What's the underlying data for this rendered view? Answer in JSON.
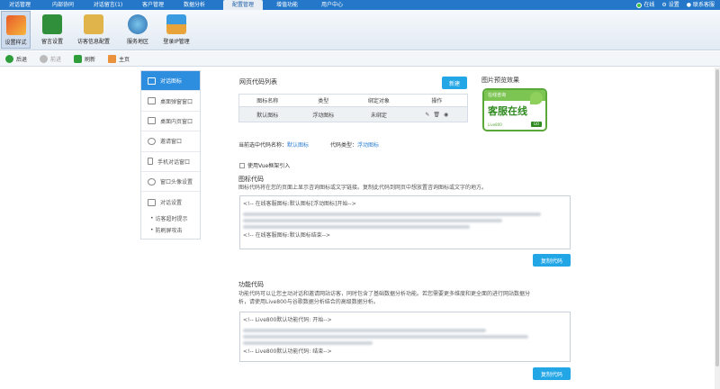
{
  "topbar": {
    "tabs": [
      "对话管理",
      "内部协同",
      "对话留言(1)",
      "客户管理",
      "数据分析",
      "配置管理",
      "增值功能",
      "用户中心"
    ],
    "active_tab": "配置管理",
    "status": "在线",
    "settings": "设置",
    "contact": "联系客服"
  },
  "toolbar": {
    "items": [
      {
        "label": "设置样式",
        "icon": "paint-brush-icon"
      },
      {
        "label": "留言设置",
        "icon": "message-book-icon"
      },
      {
        "label": "访客信息配置",
        "icon": "visitor-box-icon"
      },
      {
        "label": "服务地区",
        "icon": "globe-icon"
      },
      {
        "label": "登录IP管理",
        "icon": "ip-map-icon"
      }
    ]
  },
  "navbar": {
    "back": "后退",
    "forward": "前进",
    "refresh": "刷新",
    "home": "主页"
  },
  "left_menu": {
    "items": [
      "对话图标",
      "桌面弹窗窗口",
      "桌面内页窗口",
      "邀请窗口",
      "手机对话窗口",
      "窗口头像设置",
      "对话设置"
    ],
    "sub_items": [
      "访客超时提示",
      "防刷屏攻击"
    ]
  },
  "code_list": {
    "title": "网页代码列表",
    "new_button": "新建",
    "columns": [
      "图标名称",
      "类型",
      "绑定对象",
      "操作"
    ],
    "rows": [
      {
        "name": "默认图标",
        "type": "浮动图标",
        "bind": "未绑定"
      }
    ]
  },
  "preview": {
    "title": "图片预览效果",
    "badge_top": "在线咨询",
    "badge_main": "客服在线",
    "badge_sub": "Live800",
    "badge_btn": "GO"
  },
  "selected": {
    "name_label": "当前选中代码名称：",
    "name_value": "默认图标",
    "type_label": "代码类型：",
    "type_value": "浮动图标"
  },
  "vue_option": "使用Vue框架引入",
  "icon_code": {
    "title": "图标代码",
    "desc": "图标代码将在您的页面上显示咨询图标或文字链接。复制此代码到网页中想放置咨询图标或文字的地方。",
    "line_start": "<!-- 在线客服图标:默认图标[浮动图标]开始-->",
    "line_end": "<!-- 在线客服图标:默认图标结束-->",
    "copy_button": "复制代码"
  },
  "func_code": {
    "title": "功能代码",
    "desc_line1": "功能代码可以让您主动对话和邀请网站访客，同时包含了基础数据分析功能。若您需要更多维度和更全面的进行网站数据分",
    "desc_line2": "析，请使用Live800与谷歌数据分析结合的高级数据分析。",
    "line_start": "<!-- Live800默认功能代码: 开始-->",
    "line_end": "<!-- Live800默认功能代码: 结束-->",
    "copy_button": "复制代码"
  },
  "colors": {
    "accent": "#22a6e6",
    "topbar": "#2577c9",
    "menu_active": "#2d8ee0"
  }
}
